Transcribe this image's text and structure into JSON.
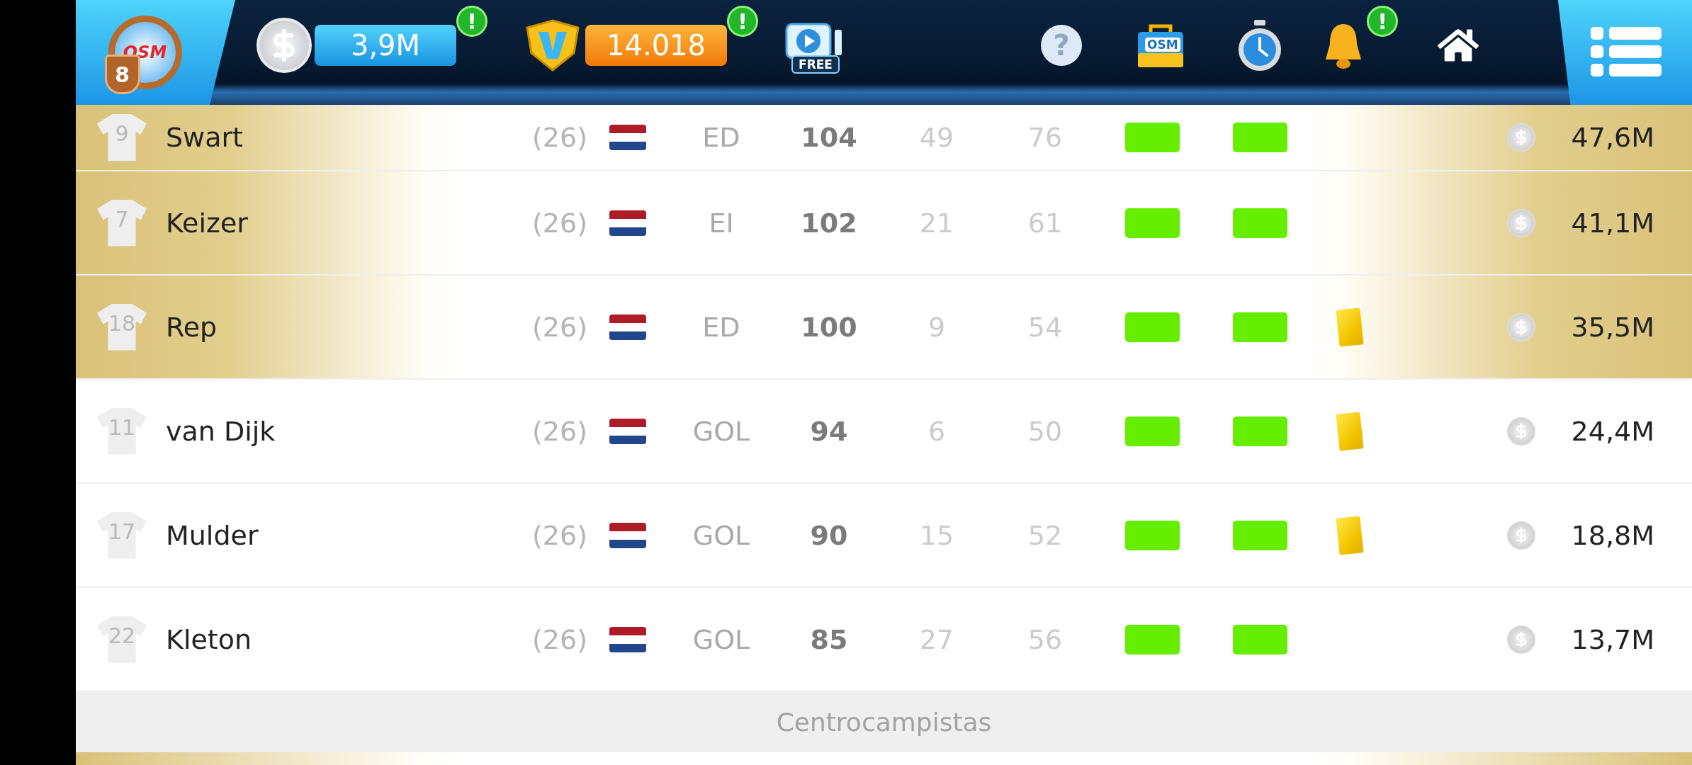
{
  "header": {
    "club_badge": {
      "logo": "OSM",
      "level": "8"
    },
    "money": {
      "value": "3,9M",
      "alert": "!"
    },
    "credits": {
      "value": "14.018",
      "alert": "!"
    },
    "video_reward": {
      "label": "FREE"
    },
    "help": "?",
    "shop_label": "OSM",
    "notifications": {
      "alert": "!"
    }
  },
  "players": [
    {
      "number": "9",
      "name": "Swart",
      "age": "(26)",
      "position": "ED",
      "rating": "104",
      "column_7": "49",
      "column_8": "76",
      "yellow_card": false,
      "highlighted": true,
      "value": "47,6M"
    },
    {
      "number": "7",
      "name": "Keizer",
      "age": "(26)",
      "position": "EI",
      "rating": "102",
      "column_7": "21",
      "column_8": "61",
      "yellow_card": false,
      "highlighted": true,
      "value": "41,1M"
    },
    {
      "number": "18",
      "name": "Rep",
      "age": "(26)",
      "position": "ED",
      "rating": "100",
      "column_7": "9",
      "column_8": "54",
      "yellow_card": true,
      "highlighted": true,
      "value": "35,5M"
    },
    {
      "number": "11",
      "name": "van Dijk",
      "age": "(26)",
      "position": "GOL",
      "rating": "94",
      "column_7": "6",
      "column_8": "50",
      "yellow_card": true,
      "highlighted": false,
      "value": "24,4M"
    },
    {
      "number": "17",
      "name": "Mulder",
      "age": "(26)",
      "position": "GOL",
      "rating": "90",
      "column_7": "15",
      "column_8": "52",
      "yellow_card": true,
      "highlighted": false,
      "value": "18,8M"
    },
    {
      "number": "22",
      "name": "Kleton",
      "age": "(26)",
      "position": "GOL",
      "rating": "85",
      "column_7": "27",
      "column_8": "56",
      "yellow_card": false,
      "highlighted": false,
      "value": "13,7M"
    }
  ],
  "section": {
    "title": "Centrocampistas"
  }
}
